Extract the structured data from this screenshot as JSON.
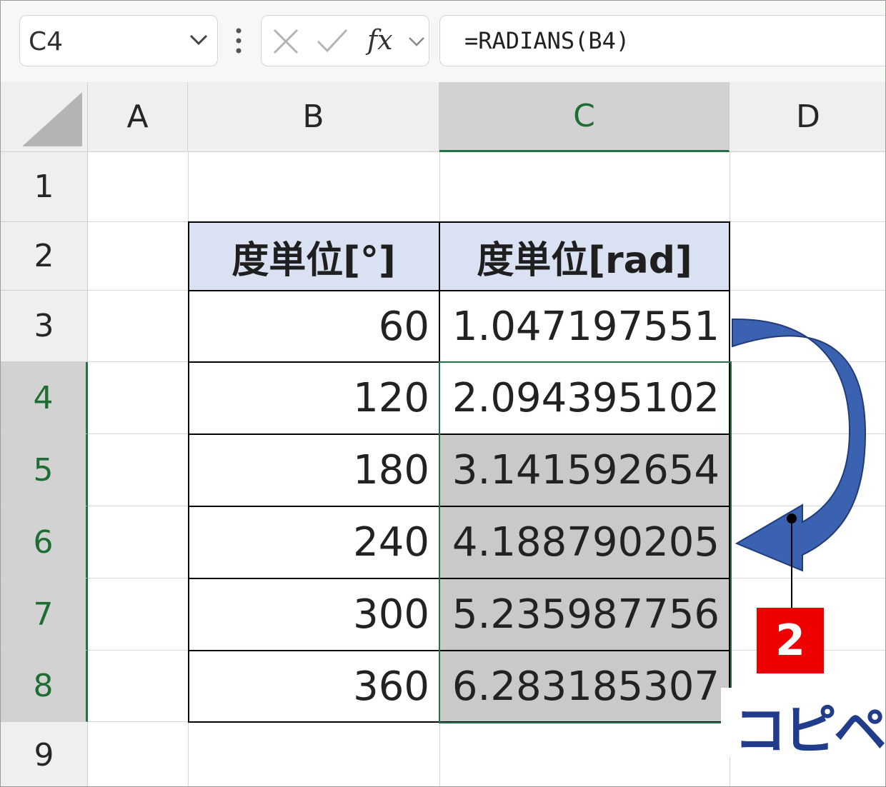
{
  "name_box": {
    "value": "C4"
  },
  "formula_bar": {
    "formula": "=RADIANS(B4)",
    "fx_label": "fx"
  },
  "columns": [
    "A",
    "B",
    "C",
    "D"
  ],
  "selected_column": "C",
  "rows": [
    "1",
    "2",
    "3",
    "4",
    "5",
    "6",
    "7",
    "8",
    "9"
  ],
  "selected_rows": [
    "4",
    "5",
    "6",
    "7",
    "8"
  ],
  "table": {
    "headers": [
      "度単位[°]",
      "度単位[rad]"
    ],
    "rows": [
      {
        "deg": "60",
        "rad": "1.047197551"
      },
      {
        "deg": "120",
        "rad": "2.094395102"
      },
      {
        "deg": "180",
        "rad": "3.141592654"
      },
      {
        "deg": "240",
        "rad": "4.188790205"
      },
      {
        "deg": "300",
        "rad": "5.235987756"
      },
      {
        "deg": "360",
        "rad": "6.283185307"
      }
    ]
  },
  "annotation": {
    "step": "2",
    "label": "コピペ"
  },
  "colors": {
    "accent": "#217346",
    "header_fill": "#d9e1f2",
    "badge": "#ee0000",
    "arrow": "#3a62b0",
    "label": "#223c8c"
  }
}
